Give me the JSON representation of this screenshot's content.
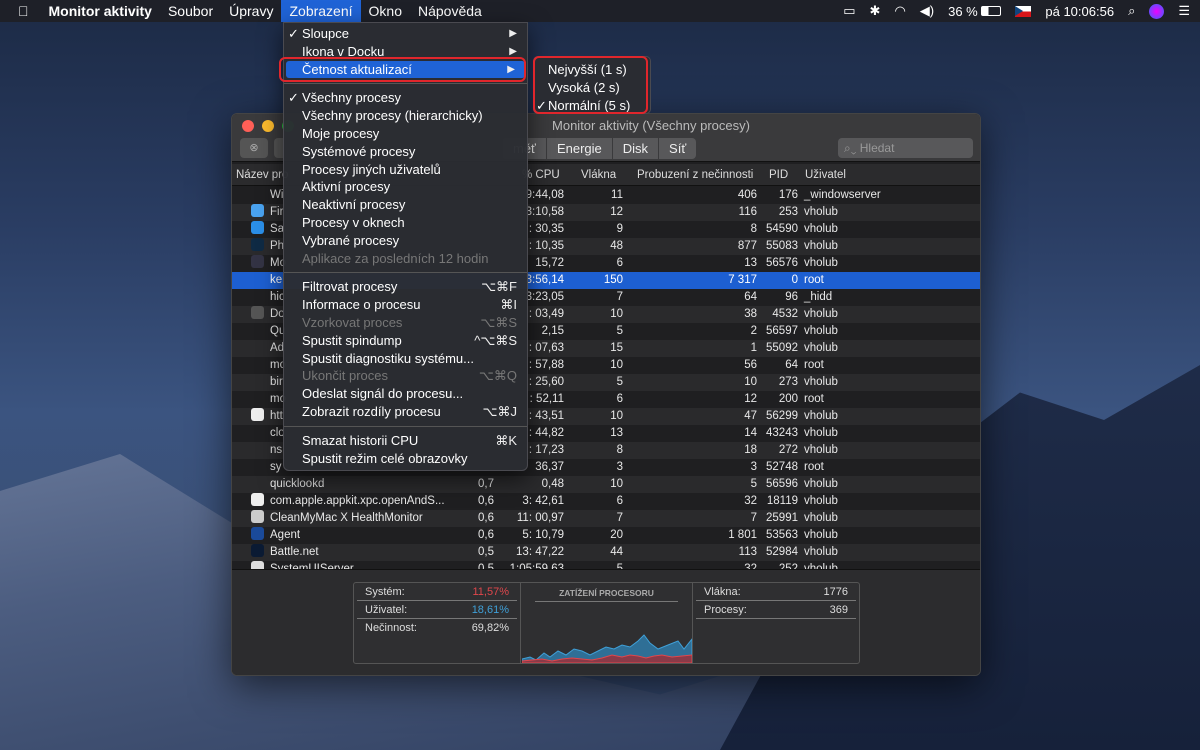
{
  "menubar": {
    "apple": "",
    "items": [
      "Monitor aktivity",
      "Soubor",
      "Úpravy",
      "Zobrazení",
      "Okno",
      "Nápověda"
    ],
    "active": "Zobrazení",
    "battery": "36 %",
    "clock": "pá 10:06:56"
  },
  "window": {
    "title": "Monitor aktivity (Všechny procesy)",
    "tabs": [
      "měť",
      "Energie",
      "Disk",
      "Síť"
    ],
    "search_placeholder": "Hledat"
  },
  "table": {
    "headers": [
      "Název pro",
      "% CPU",
      "Vlákna",
      "Probuzení z nečinnosti",
      "PID",
      "Uživatel"
    ],
    "rows": [
      [
        "Wi",
        "",
        "9:44,08",
        "11",
        "406",
        "176",
        "_windowserver"
      ],
      [
        "Fir",
        "",
        "3:10,58",
        "12",
        "116",
        "253",
        "vholub"
      ],
      [
        "Sa",
        "",
        ": 30,35",
        "9",
        "8",
        "54590",
        "vholub"
      ],
      [
        "Ph",
        "",
        ": 10,35",
        "48",
        "877",
        "55083",
        "vholub"
      ],
      [
        "Mo",
        "",
        "15,72",
        "6",
        "13",
        "56576",
        "vholub"
      ],
      [
        "ke",
        "",
        "3:56,14",
        "150",
        "7 317",
        "0",
        "root"
      ],
      [
        "hic",
        "",
        "3:23,05",
        "7",
        "64",
        "96",
        "_hidd"
      ],
      [
        "Do",
        "",
        ": 03,49",
        "10",
        "38",
        "4532",
        "vholub"
      ],
      [
        "Qu",
        "",
        "2,15",
        "5",
        "2",
        "56597",
        "vholub"
      ],
      [
        "Ad",
        "",
        ": 07,63",
        "15",
        "1",
        "55092",
        "vholub"
      ],
      [
        "mo",
        "",
        ": 57,88",
        "10",
        "56",
        "64",
        "root"
      ],
      [
        "bir",
        "",
        ": 25,60",
        "5",
        "10",
        "273",
        "vholub"
      ],
      [
        "mo",
        "",
        ": 52,11",
        "6",
        "12",
        "200",
        "root"
      ],
      [
        "htt",
        "",
        ": 43,51",
        "10",
        "47",
        "56299",
        "vholub"
      ],
      [
        "clo",
        "",
        ": 44,82",
        "13",
        "14",
        "43243",
        "vholub"
      ],
      [
        "ns",
        "",
        ": 17,23",
        "8",
        "18",
        "272",
        "vholub"
      ],
      [
        "sy",
        "",
        "36,37",
        "3",
        "3",
        "52748",
        "root"
      ],
      [
        "quicklookd",
        "0,7",
        "0,48",
        "10",
        "5",
        "56596",
        "vholub"
      ],
      [
        "com.apple.appkit.xpc.openAndS...",
        "0,6",
        "3: 42,61",
        "6",
        "32",
        "18119",
        "vholub"
      ],
      [
        "CleanMyMac X HealthMonitor",
        "0,6",
        "11: 00,97",
        "7",
        "7",
        "25991",
        "vholub"
      ],
      [
        "Agent",
        "0,6",
        "5: 10,79",
        "20",
        "1 801",
        "53563",
        "vholub"
      ],
      [
        "Battle.net",
        "0,5",
        "13: 47,22",
        "44",
        "113",
        "52984",
        "vholub"
      ],
      [
        "SystemUIServer",
        "0,5",
        "1:05:59,63",
        "5",
        "32",
        "252",
        "vholub"
      ]
    ],
    "selected_row": 5
  },
  "stats": {
    "system_label": "Systém:",
    "system": "11,57%",
    "user_label": "Uživatel:",
    "user": "18,61%",
    "idle_label": "Nečinnost:",
    "idle": "69,82%",
    "graph_title": "ZATÍŽENÍ PROCESORU",
    "threads_label": "Vlákna:",
    "threads": "1776",
    "procs_label": "Procesy:",
    "procs": "369",
    "system_color": "#e0474c",
    "user_color": "#3fa0d8"
  },
  "menu": {
    "items": [
      {
        "label": "Sloupce",
        "check": "✓",
        "arrow": "▶"
      },
      {
        "label": "Ikona v Docku",
        "arrow": "▶"
      },
      {
        "label": "Četnost aktualizací",
        "arrow": "▶",
        "highlight": true
      },
      {
        "sep": true
      },
      {
        "label": "Všechny procesy",
        "check": "✓"
      },
      {
        "label": "Všechny procesy (hierarchicky)"
      },
      {
        "label": "Moje procesy"
      },
      {
        "label": "Systémové procesy"
      },
      {
        "label": "Procesy jiných uživatelů"
      },
      {
        "label": "Aktivní procesy"
      },
      {
        "label": "Neaktivní procesy"
      },
      {
        "label": "Procesy v oknech"
      },
      {
        "label": "Vybrané procesy"
      },
      {
        "label": "Aplikace za posledních 12 hodin",
        "disabled": true
      },
      {
        "sep": true
      },
      {
        "label": "Filtrovat procesy",
        "shortcut": "⌥⌘F"
      },
      {
        "label": "Informace o procesu",
        "shortcut": "⌘I"
      },
      {
        "label": "Vzorkovat proces",
        "shortcut": "⌥⌘S",
        "disabled": true
      },
      {
        "label": "Spustit spindump",
        "shortcut": "^⌥⌘S"
      },
      {
        "label": "Spustit diagnostiku systému..."
      },
      {
        "label": "Ukončit proces",
        "shortcut": "⌥⌘Q",
        "disabled": true
      },
      {
        "label": "Odeslat signál do procesu..."
      },
      {
        "label": "Zobrazit rozdíly procesu",
        "shortcut": "⌥⌘J"
      },
      {
        "sep": true
      },
      {
        "label": "Smazat historii CPU",
        "shortcut": "⌘K"
      },
      {
        "label": "Spustit režim celé obrazovky"
      }
    ]
  },
  "submenu": {
    "items": [
      {
        "label": "Nejvyšší (1 s)"
      },
      {
        "label": "Vysoká (2 s)"
      },
      {
        "label": "Normální (5 s)",
        "check": "✓"
      }
    ]
  }
}
